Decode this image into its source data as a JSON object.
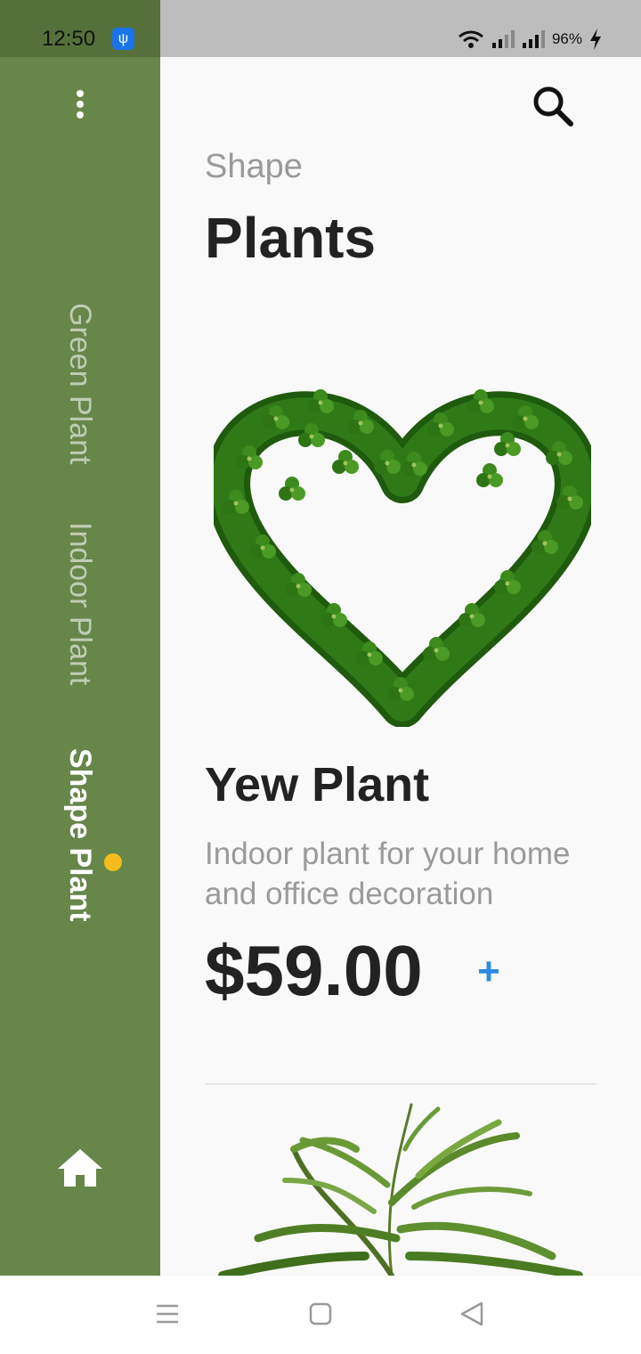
{
  "status_bar": {
    "time": "12:50",
    "battery": "96%"
  },
  "sidebar": {
    "categories": [
      {
        "label": "Green Plant",
        "active": false
      },
      {
        "label": "Indoor Plant",
        "active": false
      },
      {
        "label": "Shape Plant",
        "active": true
      }
    ],
    "icons": [
      "more-vertical-icon",
      "home-icon"
    ],
    "background_color": "#66864a",
    "active_indicator_color": "#f4bc1c"
  },
  "header": {
    "subtitle": "Shape",
    "title": "Plants",
    "search_icon": "search-icon"
  },
  "product": {
    "name": "Yew Plant",
    "description": "Indoor plant for your home and office decoration",
    "price": "$59.00",
    "add_label": "+",
    "accent_color": "#2b8ce0"
  },
  "nav_bar": {
    "icons": [
      "menu-icon",
      "home-square-icon",
      "back-icon"
    ]
  }
}
